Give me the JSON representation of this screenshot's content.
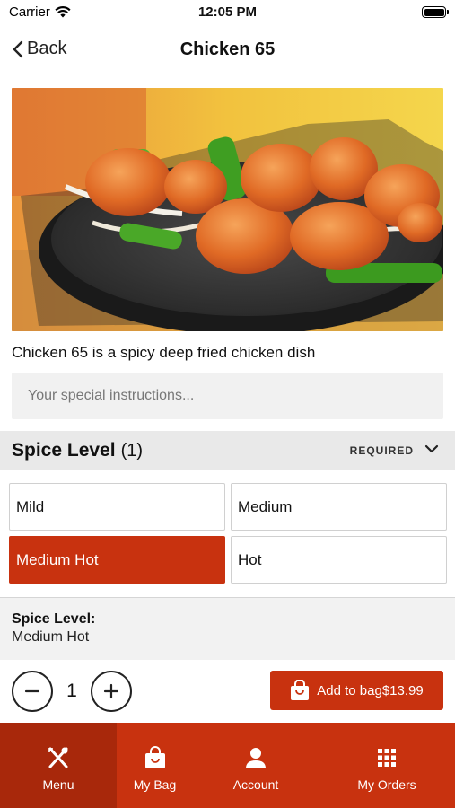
{
  "status_bar": {
    "carrier": "Carrier",
    "time": "12:05 PM"
  },
  "nav": {
    "back_label": "Back",
    "title": "Chicken 65"
  },
  "item": {
    "description": "Chicken 65 is a spicy deep fried chicken dish",
    "instructions_placeholder": "Your special instructions..."
  },
  "spice": {
    "title": "Spice Level",
    "count": "(1)",
    "required_label": "REQUIRED",
    "options": [
      {
        "label": "Mild",
        "selected": false
      },
      {
        "label": "Medium",
        "selected": false
      },
      {
        "label": "Medium Hot",
        "selected": true
      },
      {
        "label": "Hot",
        "selected": false
      }
    ]
  },
  "summary": {
    "label": "Spice Level:",
    "value": "Medium Hot"
  },
  "order": {
    "quantity": "1",
    "add_label": "Add to bag",
    "price": "$13.99"
  },
  "tabs": [
    {
      "label": "Menu",
      "icon": "fork-knife-icon",
      "active": true
    },
    {
      "label": "My Bag",
      "icon": "shopping-bag-icon",
      "active": false
    },
    {
      "label": "Account",
      "icon": "person-icon",
      "active": false
    },
    {
      "label": "My Orders",
      "icon": "grid-icon",
      "active": false
    }
  ],
  "colors": {
    "accent": "#c8320f",
    "accent_dark": "#a8280b",
    "section_bg": "#e9e9e9"
  }
}
